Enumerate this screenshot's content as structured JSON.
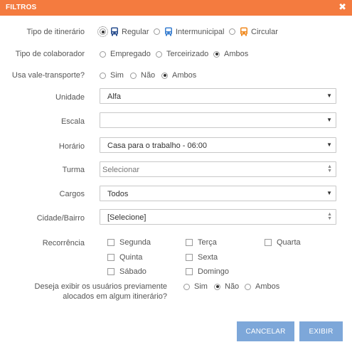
{
  "header": {
    "title": "FILTROS",
    "close_glyph": "✖"
  },
  "itinerary_type": {
    "label": "Tipo de itinerário",
    "options": [
      {
        "label": "Regular",
        "selected": true,
        "icon": "bus-icon",
        "color": "#2a4f8f"
      },
      {
        "label": "Intermunicipal",
        "selected": false,
        "icon": "bus-icon",
        "color": "#3a7fd0"
      },
      {
        "label": "Circular",
        "selected": false,
        "icon": "bus-icon",
        "color": "#f08a20"
      }
    ]
  },
  "employee_type": {
    "label": "Tipo de colaborador",
    "options": [
      {
        "label": "Empregado",
        "selected": false
      },
      {
        "label": "Terceirizado",
        "selected": false
      },
      {
        "label": "Ambos",
        "selected": true
      }
    ]
  },
  "transport_voucher": {
    "label": "Usa vale-transporte?",
    "options": [
      {
        "label": "Sim",
        "selected": false
      },
      {
        "label": "Não",
        "selected": false
      },
      {
        "label": "Ambos",
        "selected": true
      }
    ]
  },
  "fields": {
    "unidade": {
      "label": "Unidade",
      "value": "Alfa"
    },
    "escala": {
      "label": "Escala",
      "value": ""
    },
    "horario": {
      "label": "Horário",
      "value": "Casa para o trabalho - 06:00"
    },
    "turma": {
      "label": "Turma",
      "placeholder": "Selecionar"
    },
    "cargos": {
      "label": "Cargos",
      "value": "Todos"
    },
    "cidade": {
      "label": "Cidade/Bairro",
      "value": "[Selecione]"
    }
  },
  "recurrence": {
    "label": "Recorrência",
    "days": [
      "Segunda",
      "Terça",
      "Quarta",
      "Quinta",
      "Sexta",
      "Sábado",
      "Domingo"
    ]
  },
  "allocated": {
    "question_line1": "Deseja exibir os usuários previamente",
    "question_line2": "alocados em algum itinerário?",
    "options": [
      {
        "label": "Sim",
        "selected": false
      },
      {
        "label": "Não",
        "selected": true
      },
      {
        "label": "Ambos",
        "selected": false
      }
    ]
  },
  "buttons": {
    "cancel": "CANCELAR",
    "submit": "EXIBIR"
  },
  "colors": {
    "header": "#f47b3f",
    "button": "#7da7d9"
  }
}
